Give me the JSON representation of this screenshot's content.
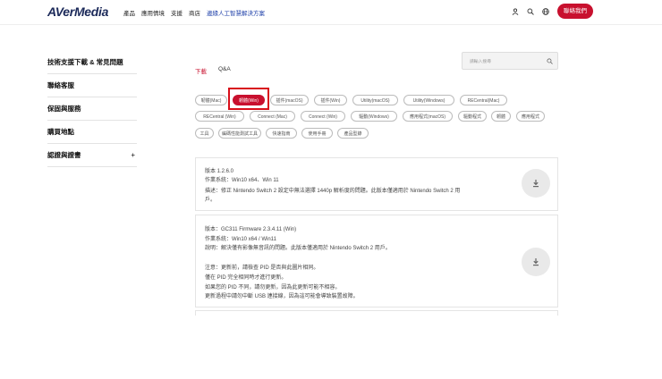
{
  "header": {
    "logo": {
      "av": "AVer",
      "media": "Media"
    },
    "nav": [
      "產品",
      "應用情境",
      "支援",
      "商店",
      "邊緣人工智慧解決方案"
    ],
    "icons": [
      "user-icon",
      "search-icon",
      "globe-icon"
    ],
    "contact_label": "聯絡我們"
  },
  "sidebar": {
    "items": [
      {
        "label": "技術支援下載 & 常見問題"
      },
      {
        "label": "聯絡客服"
      },
      {
        "label": "保固與服務"
      },
      {
        "label": "購買地點"
      },
      {
        "label": "認證與證書",
        "expand": "+"
      }
    ]
  },
  "tabs": [
    {
      "label": "下載",
      "active": true
    },
    {
      "label": "Q&A",
      "active": false
    }
  ],
  "search": {
    "placeholder": "請輸入搜尋"
  },
  "filters": [
    {
      "label": "韌體(Mac)"
    },
    {
      "label": "韌體(Win)",
      "active": true
    },
    {
      "label": "插件(macOS)"
    },
    {
      "label": "插件(Win)"
    },
    {
      "label": "Utility(macOS)"
    },
    {
      "label": "Utility(Windows)"
    },
    {
      "label": "RECentral(Mac)"
    },
    {
      "label": "RECentral (Win)"
    },
    {
      "label": "Connect (Mac)"
    },
    {
      "label": "Connect (Win)"
    },
    {
      "label": "驅動(Windows)"
    },
    {
      "label": "應用程式(macOS)"
    },
    {
      "label": "驅動程式"
    },
    {
      "label": "韌體"
    },
    {
      "label": "應用程式"
    },
    {
      "label": "工具"
    },
    {
      "label": "編碼性能測試工具"
    },
    {
      "label": "快速指南"
    },
    {
      "label": "使用手冊"
    },
    {
      "label": "產品型錄"
    }
  ],
  "downloads": [
    {
      "lines": [
        "版本 1.2.6.0",
        "作業系統：Win10 x64、Win 11",
        "描述：修正 Nintendo Switch 2 設定中無法選擇 1440p 解析度的問題。此版本僅適用於 Nintendo Switch 2 用",
        "戶。"
      ]
    },
    {
      "lines": [
        "版本：GC311 Firmware 2.3.4.11 (Win)",
        "作業系統：Win10 x64 / Win11",
        "說明：解決僅有影像無音訊的問題。此版本僅適用於 Nintendo Switch 2 用戶。",
        "",
        "注意：更新前，請檢查 PID 是否與此圖片相同。",
        "僅在 PID 完全相同時才進行更新。",
        "如果您的 PID 不同，請勿更新，因為此更新可能不相容。",
        "更新過程中請勿中斷 USB 連接線，因為這可能會導致裝置故障。"
      ]
    }
  ]
}
